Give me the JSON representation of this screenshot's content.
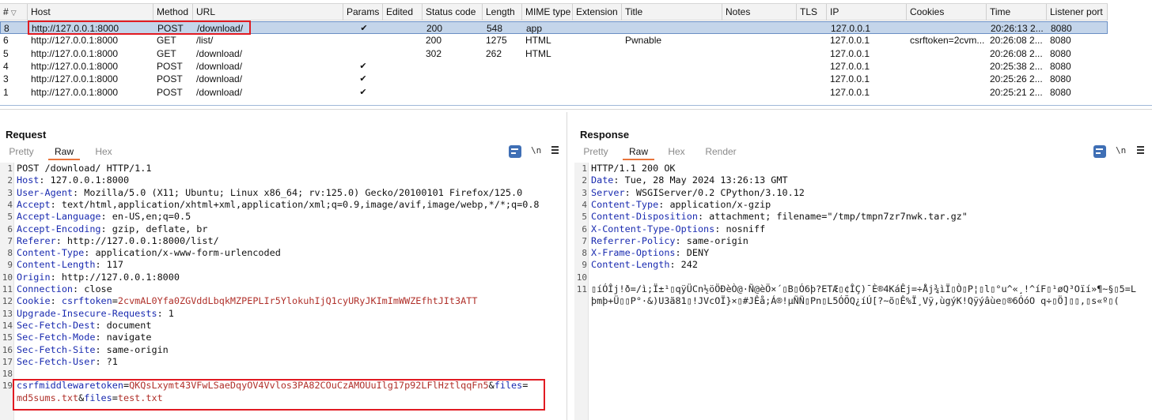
{
  "history": {
    "columns": [
      "#",
      "Host",
      "Method",
      "URL",
      "Params",
      "Edited",
      "Status code",
      "Length",
      "MIME type",
      "Extension",
      "Title",
      "Notes",
      "TLS",
      "IP",
      "Cookies",
      "Time",
      "Listener port"
    ],
    "sort_icon": "sort-desc-icon",
    "check_mark": "✔",
    "rows": [
      {
        "num": "8",
        "host": "http://127.0.0.1:8000",
        "method": "POST",
        "url": "/download/",
        "params": true,
        "status": "200",
        "length": "548",
        "mime": "app",
        "title": "",
        "ip": "127.0.0.1",
        "cookies": "",
        "time": "20:26:13 2...",
        "port": "8080",
        "selected": true
      },
      {
        "num": "6",
        "host": "http://127.0.0.1:8000",
        "method": "GET",
        "url": "/list/",
        "params": false,
        "status": "200",
        "length": "1275",
        "mime": "HTML",
        "title": "Pwnable",
        "ip": "127.0.0.1",
        "cookies": "csrftoken=2cvm...",
        "time": "20:26:08 2...",
        "port": "8080",
        "selected": false
      },
      {
        "num": "5",
        "host": "http://127.0.0.1:8000",
        "method": "GET",
        "url": "/download/",
        "params": false,
        "status": "302",
        "length": "262",
        "mime": "HTML",
        "title": "",
        "ip": "127.0.0.1",
        "cookies": "",
        "time": "20:26:08 2...",
        "port": "8080",
        "selected": false
      },
      {
        "num": "4",
        "host": "http://127.0.0.1:8000",
        "method": "POST",
        "url": "/download/",
        "params": true,
        "status": "",
        "length": "",
        "mime": "",
        "title": "",
        "ip": "127.0.0.1",
        "cookies": "",
        "time": "20:25:38 2...",
        "port": "8080",
        "selected": false
      },
      {
        "num": "3",
        "host": "http://127.0.0.1:8000",
        "method": "POST",
        "url": "/download/",
        "params": true,
        "status": "",
        "length": "",
        "mime": "",
        "title": "",
        "ip": "127.0.0.1",
        "cookies": "",
        "time": "20:25:26 2...",
        "port": "8080",
        "selected": false
      },
      {
        "num": "1",
        "host": "http://127.0.0.1:8000",
        "method": "POST",
        "url": "/download/",
        "params": true,
        "status": "",
        "length": "",
        "mime": "",
        "title": "",
        "ip": "127.0.0.1",
        "cookies": "",
        "time": "20:25:21 2...",
        "port": "8080",
        "selected": false
      }
    ]
  },
  "request": {
    "title": "Request",
    "tabs": [
      "Pretty",
      "Raw",
      "Hex"
    ],
    "active_tab": "Raw",
    "nl_label": "\\n",
    "lines": [
      {
        "n": "1",
        "plain": "POST /download/ HTTP/1.1"
      },
      {
        "n": "2",
        "name": "Host",
        "value": " 127.0.0.1:8000"
      },
      {
        "n": "3",
        "name": "User-Agent",
        "value": " Mozilla/5.0 (X11; Ubuntu; Linux x86_64; rv:125.0) Gecko/20100101 Firefox/125.0"
      },
      {
        "n": "4",
        "name": "Accept",
        "value": " text/html,application/xhtml+xml,application/xml;q=0.9,image/avif,image/webp,*/*;q=0.8"
      },
      {
        "n": "5",
        "name": "Accept-Language",
        "value": " en-US,en;q=0.5"
      },
      {
        "n": "6",
        "name": "Accept-Encoding",
        "value": " gzip, deflate, br"
      },
      {
        "n": "7",
        "name": "Referer",
        "value": " http://127.0.0.1:8000/list/"
      },
      {
        "n": "8",
        "name": "Content-Type",
        "value": " application/x-www-form-urlencoded"
      },
      {
        "n": "9",
        "name": "Content-Length",
        "value": " 117"
      },
      {
        "n": "10",
        "name": "Origin",
        "value": " http://127.0.0.1:8000"
      },
      {
        "n": "11",
        "name": "Connection",
        "value": " close"
      },
      {
        "n": "12",
        "name": "Cookie",
        "cookie_name": " csrftoken",
        "cookie_value": "2cvmAL0Yfa0ZGVddLbqkMZPEPLIr5YlokuhIjQ1cyURyJKImImWWZEfhtJIt3ATT"
      },
      {
        "n": "13",
        "name": "Upgrade-Insecure-Requests",
        "value": " 1"
      },
      {
        "n": "14",
        "name": "Sec-Fetch-Dest",
        "value": " document"
      },
      {
        "n": "15",
        "name": "Sec-Fetch-Mode",
        "value": " navigate"
      },
      {
        "n": "16",
        "name": "Sec-Fetch-Site",
        "value": " same-origin"
      },
      {
        "n": "17",
        "name": "Sec-Fetch-User",
        "value": " ?1"
      },
      {
        "n": "18",
        "plain": ""
      },
      {
        "n": "19",
        "body": true
      }
    ],
    "body": {
      "token_key": "csrfmiddlewaretoken",
      "token_value": "QKQsLxymt43VFwLSaeDqyOV4Vvlos3PA82COuCzAMOUuIlg17p92LFlHztlqqFn5",
      "files_key_1": "files",
      "files_val_1": "md5sums.txt",
      "files_key_2": "files",
      "files_val_2": "test.txt"
    }
  },
  "response": {
    "title": "Response",
    "tabs": [
      "Pretty",
      "Raw",
      "Hex",
      "Render"
    ],
    "active_tab": "Raw",
    "nl_label": "\\n",
    "lines": [
      {
        "n": "1",
        "plain": "HTTP/1.1 200 OK"
      },
      {
        "n": "2",
        "name": "Date",
        "value": " Tue, 28 May 2024 13:26:13 GMT"
      },
      {
        "n": "3",
        "name": "Server",
        "value": " WSGIServer/0.2 CPython/3.10.12"
      },
      {
        "n": "4",
        "name": "Content-Type",
        "value": " application/x-gzip"
      },
      {
        "n": "5",
        "name": "Content-Disposition",
        "value": " attachment; filename=\"/tmp/tmpn7zr7nwk.tar.gz\""
      },
      {
        "n": "6",
        "name": "X-Content-Type-Options",
        "value": " nosniff"
      },
      {
        "n": "7",
        "name": "Referrer-Policy",
        "value": " same-origin"
      },
      {
        "n": "8",
        "name": "X-Frame-Options",
        "value": " DENY"
      },
      {
        "n": "9",
        "name": "Content-Length",
        "value": " 242"
      },
      {
        "n": "10",
        "plain": ""
      },
      {
        "n": "11",
        "binary": "▯íÓÎj!ð=/ì;Ï±¹▯qÿÜCn½öÖÐèÒ@·Ñ@èÖ×´▯B▯Ó6þ?ETÆ▯¢ÎÇ)¯È®4KáÊj=÷Åj¾ìÏ▯Ò▯P¦▯l▯°u^«¸!^íF▯¹øQ³Oïí»¶~§▯5=L"
      },
      {
        "n": "",
        "binary": "þmþ+Ü▯▯P°·&)U3ã81▯!JVcOÏ}×▯#JÊå;Á®!µÑÑ▯Pn▯L5ÓÕQ¿íÚ[?~õ▯Ê%Ï¸Vÿ,ùgýK!Qÿýâùe▯®6ÓóO q÷▯Ö]▯▯,▯s«º▯("
      }
    ]
  }
}
